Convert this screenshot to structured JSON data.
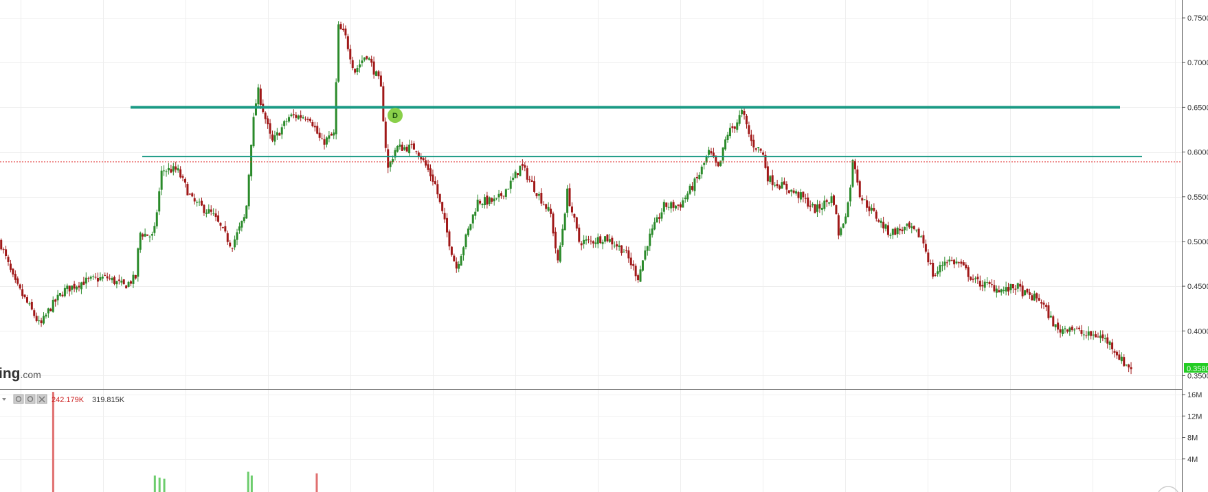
{
  "brand": {
    "logo_main": "ing",
    "logo_suffix": ".com"
  },
  "volume_panel": {
    "values": [
      "242.179K",
      "319.815K"
    ]
  },
  "colors": {
    "up": "#2a8a2a",
    "down": "#a01818",
    "trendline": "#1a9a84",
    "price_marker": "#e03030",
    "last_price_bg": "#22cc22",
    "event_marker": "#8ad04a"
  },
  "icons": [
    "dropdown-arrow-icon",
    "settings-icon",
    "visibility-icon",
    "close-icon"
  ],
  "chart_data": [
    {
      "type": "candlestick",
      "ylim": [
        0.335,
        0.77
      ],
      "y_ticks": [
        "0.7500",
        "0.7000",
        "0.6500",
        "0.6000",
        "0.5500",
        "0.5000",
        "0.4500",
        "0.4000",
        "0.3500"
      ],
      "last_price_label": "0.3580",
      "last_price": 0.358,
      "reference_price": 0.589,
      "horizontal_lines": [
        {
          "y": 0.65,
          "role": "resistance-upper"
        },
        {
          "y": 0.595,
          "role": "resistance-lower"
        }
      ],
      "event_marker": {
        "label": "D",
        "at_price": 0.641
      },
      "grid": true,
      "close_path": [
        [
          0,
          0.5
        ],
        [
          0.012,
          0.455
        ],
        [
          0.028,
          0.42
        ],
        [
          0.034,
          0.405
        ],
        [
          0.042,
          0.425
        ],
        [
          0.054,
          0.445
        ],
        [
          0.07,
          0.455
        ],
        [
          0.09,
          0.46
        ],
        [
          0.105,
          0.45
        ],
        [
          0.115,
          0.46
        ],
        [
          0.118,
          0.51
        ],
        [
          0.13,
          0.505
        ],
        [
          0.137,
          0.58
        ],
        [
          0.15,
          0.58
        ],
        [
          0.163,
          0.545
        ],
        [
          0.18,
          0.53
        ],
        [
          0.196,
          0.495
        ],
        [
          0.208,
          0.53
        ],
        [
          0.213,
          0.62
        ],
        [
          0.218,
          0.67
        ],
        [
          0.23,
          0.61
        ],
        [
          0.245,
          0.64
        ],
        [
          0.262,
          0.64
        ],
        [
          0.272,
          0.61
        ],
        [
          0.283,
          0.62
        ],
        [
          0.286,
          0.74
        ],
        [
          0.292,
          0.73
        ],
        [
          0.3,
          0.69
        ],
        [
          0.31,
          0.71
        ],
        [
          0.322,
          0.675
        ],
        [
          0.328,
          0.58
        ],
        [
          0.335,
          0.605
        ],
        [
          0.352,
          0.605
        ],
        [
          0.368,
          0.565
        ],
        [
          0.38,
          0.5
        ],
        [
          0.386,
          0.47
        ],
        [
          0.398,
          0.52
        ],
        [
          0.404,
          0.545
        ],
        [
          0.42,
          0.545
        ],
        [
          0.432,
          0.565
        ],
        [
          0.441,
          0.585
        ],
        [
          0.452,
          0.56
        ],
        [
          0.466,
          0.53
        ],
        [
          0.472,
          0.475
        ],
        [
          0.48,
          0.555
        ],
        [
          0.49,
          0.5
        ],
        [
          0.5,
          0.5
        ],
        [
          0.512,
          0.505
        ],
        [
          0.528,
          0.49
        ],
        [
          0.54,
          0.46
        ],
        [
          0.548,
          0.5
        ],
        [
          0.562,
          0.54
        ],
        [
          0.575,
          0.54
        ],
        [
          0.59,
          0.57
        ],
        [
          0.6,
          0.6
        ],
        [
          0.608,
          0.58
        ],
        [
          0.615,
          0.62
        ],
        [
          0.622,
          0.63
        ],
        [
          0.628,
          0.645
        ],
        [
          0.636,
          0.61
        ],
        [
          0.645,
          0.6
        ],
        [
          0.65,
          0.57
        ],
        [
          0.665,
          0.56
        ],
        [
          0.678,
          0.55
        ],
        [
          0.69,
          0.535
        ],
        [
          0.705,
          0.55
        ],
        [
          0.71,
          0.505
        ],
        [
          0.718,
          0.545
        ],
        [
          0.722,
          0.595
        ],
        [
          0.728,
          0.55
        ],
        [
          0.74,
          0.53
        ],
        [
          0.752,
          0.51
        ],
        [
          0.768,
          0.515
        ],
        [
          0.78,
          0.505
        ],
        [
          0.79,
          0.46
        ],
        [
          0.8,
          0.48
        ],
        [
          0.812,
          0.475
        ],
        [
          0.825,
          0.455
        ],
        [
          0.838,
          0.45
        ],
        [
          0.85,
          0.445
        ],
        [
          0.86,
          0.45
        ],
        [
          0.868,
          0.44
        ],
        [
          0.88,
          0.435
        ],
        [
          0.895,
          0.4
        ],
        [
          0.905,
          0.405
        ],
        [
          0.918,
          0.395
        ],
        [
          0.93,
          0.395
        ],
        [
          0.94,
          0.385
        ],
        [
          0.95,
          0.365
        ],
        [
          0.958,
          0.358
        ]
      ]
    },
    {
      "type": "bar",
      "name": "volume",
      "y_ticks": [
        "16M",
        "12M",
        "8M",
        "4M"
      ],
      "ylim": [
        0,
        16
      ],
      "y_unit": "M",
      "bars": [
        {
          "x": 0.045,
          "value": 16.5,
          "direction": "down"
        },
        {
          "x": 0.131,
          "value": 0.9,
          "direction": "up"
        },
        {
          "x": 0.135,
          "value": 0.5,
          "direction": "up"
        },
        {
          "x": 0.139,
          "value": 0.3,
          "direction": "up"
        },
        {
          "x": 0.21,
          "value": 1.6,
          "direction": "up"
        },
        {
          "x": 0.213,
          "value": 0.9,
          "direction": "up"
        },
        {
          "x": 0.268,
          "value": 1.3,
          "direction": "down"
        }
      ]
    }
  ]
}
